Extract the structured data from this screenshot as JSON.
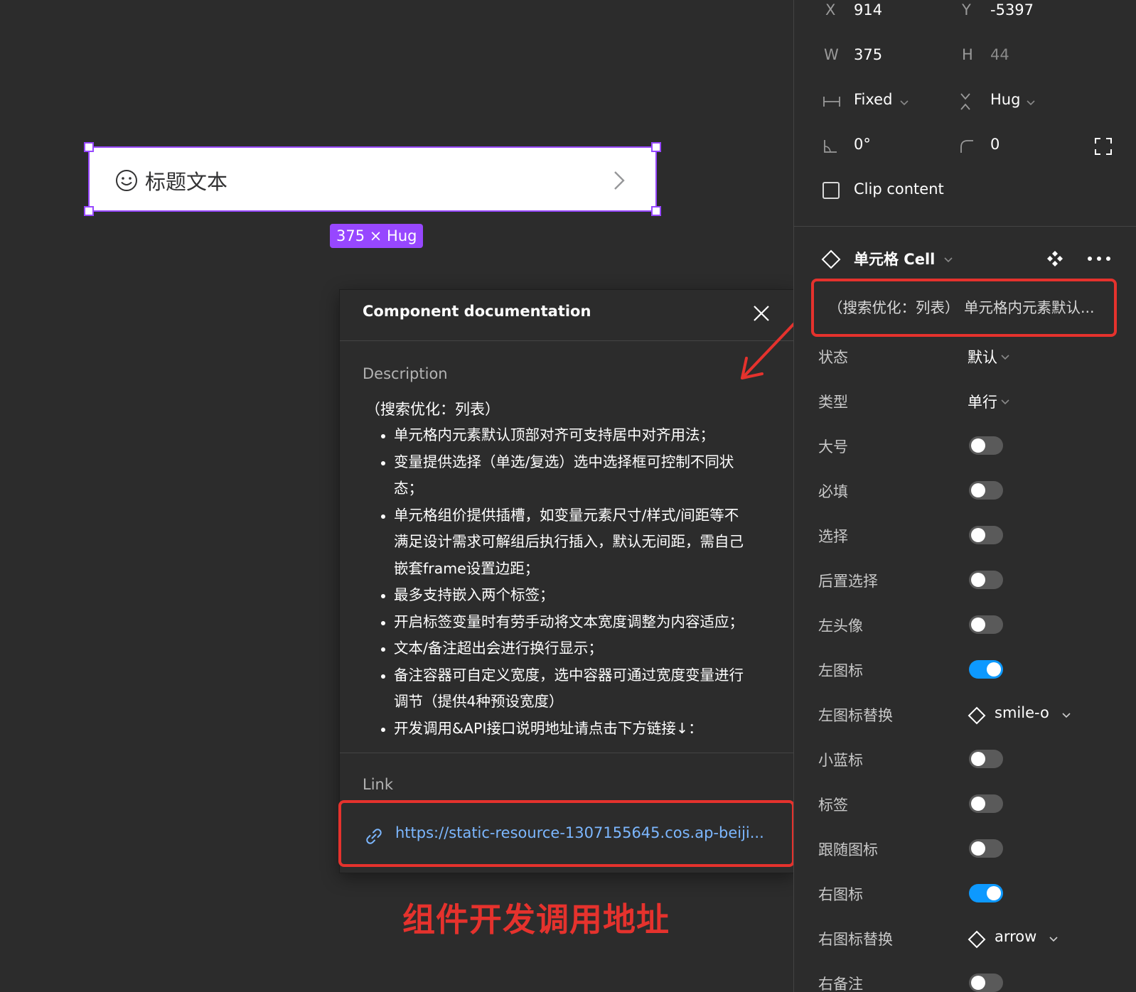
{
  "canvas": {
    "frame_title": "标题文本",
    "size_badge": "375 × Hug"
  },
  "doc_popup": {
    "title": "Component documentation",
    "description_label": "Description",
    "description_lead": "（搜索优化：列表）",
    "bullets": [
      "单元格内元素默认顶部对齐可支持居中对齐用法；",
      "变量提供选择（单选/复选）选中选择框可控制不同状",
      "态；",
      "单元格组价提供插槽，如变量元素尺寸/样式/间距等不",
      "满足设计需求可解组后执行插入，默认无间距，需自己",
      "嵌套frame设置边距；",
      "最多支持嵌入两个标签；",
      "开启标签变量时有劳手动将文本宽度调整为内容适应；",
      "文本/备注超出会进行换行显示；",
      "备注容器可自定义宽度，选中容器可通过宽度变量进行",
      "调节（提供4种预设宽度）",
      "开发调用&API接口说明地址请点击下方链接↓："
    ],
    "link_label": "Link",
    "link_url": "https://static-resource-1307155645.cos.ap-beiji..."
  },
  "annotation": {
    "text": "组件开发调用地址",
    "color": "#e5322d"
  },
  "panel": {
    "x_label": "X",
    "x_value": "914",
    "y_label": "Y",
    "y_value": "-5397",
    "w_label": "W",
    "w_value": "375",
    "h_label": "H",
    "h_value": "44",
    "width_mode": "Fixed",
    "height_mode": "Hug",
    "rotation": "0°",
    "radius": "0",
    "clip_content": "Clip content",
    "component_name": "单元格 Cell",
    "component_description": "（搜索优化：列表） 单元格内元素默认...",
    "props": [
      {
        "label": "状态",
        "type": "select",
        "value": "默认"
      },
      {
        "label": "类型",
        "type": "select",
        "value": "单行"
      },
      {
        "label": "大号",
        "type": "toggle",
        "on": false
      },
      {
        "label": "必填",
        "type": "toggle",
        "on": false
      },
      {
        "label": "选择",
        "type": "toggle",
        "on": false
      },
      {
        "label": "后置选择",
        "type": "toggle",
        "on": false
      },
      {
        "label": "左头像",
        "type": "toggle",
        "on": false
      },
      {
        "label": "左图标",
        "type": "toggle",
        "on": true
      },
      {
        "label": "左图标替换",
        "type": "instance",
        "value": "smile-o"
      },
      {
        "label": "小蓝标",
        "type": "toggle",
        "on": false
      },
      {
        "label": "标签",
        "type": "toggle",
        "on": false
      },
      {
        "label": "跟随图标",
        "type": "toggle",
        "on": false
      },
      {
        "label": "右图标",
        "type": "toggle",
        "on": true
      },
      {
        "label": "右图标替换",
        "type": "instance",
        "value": "arrow"
      },
      {
        "label": "右备注",
        "type": "toggle",
        "on": false
      }
    ]
  },
  "colors": {
    "selection": "#9747ff",
    "accent_blue": "#0d99ff",
    "annotation_red": "#e5322d",
    "link": "#7cb7ff"
  }
}
